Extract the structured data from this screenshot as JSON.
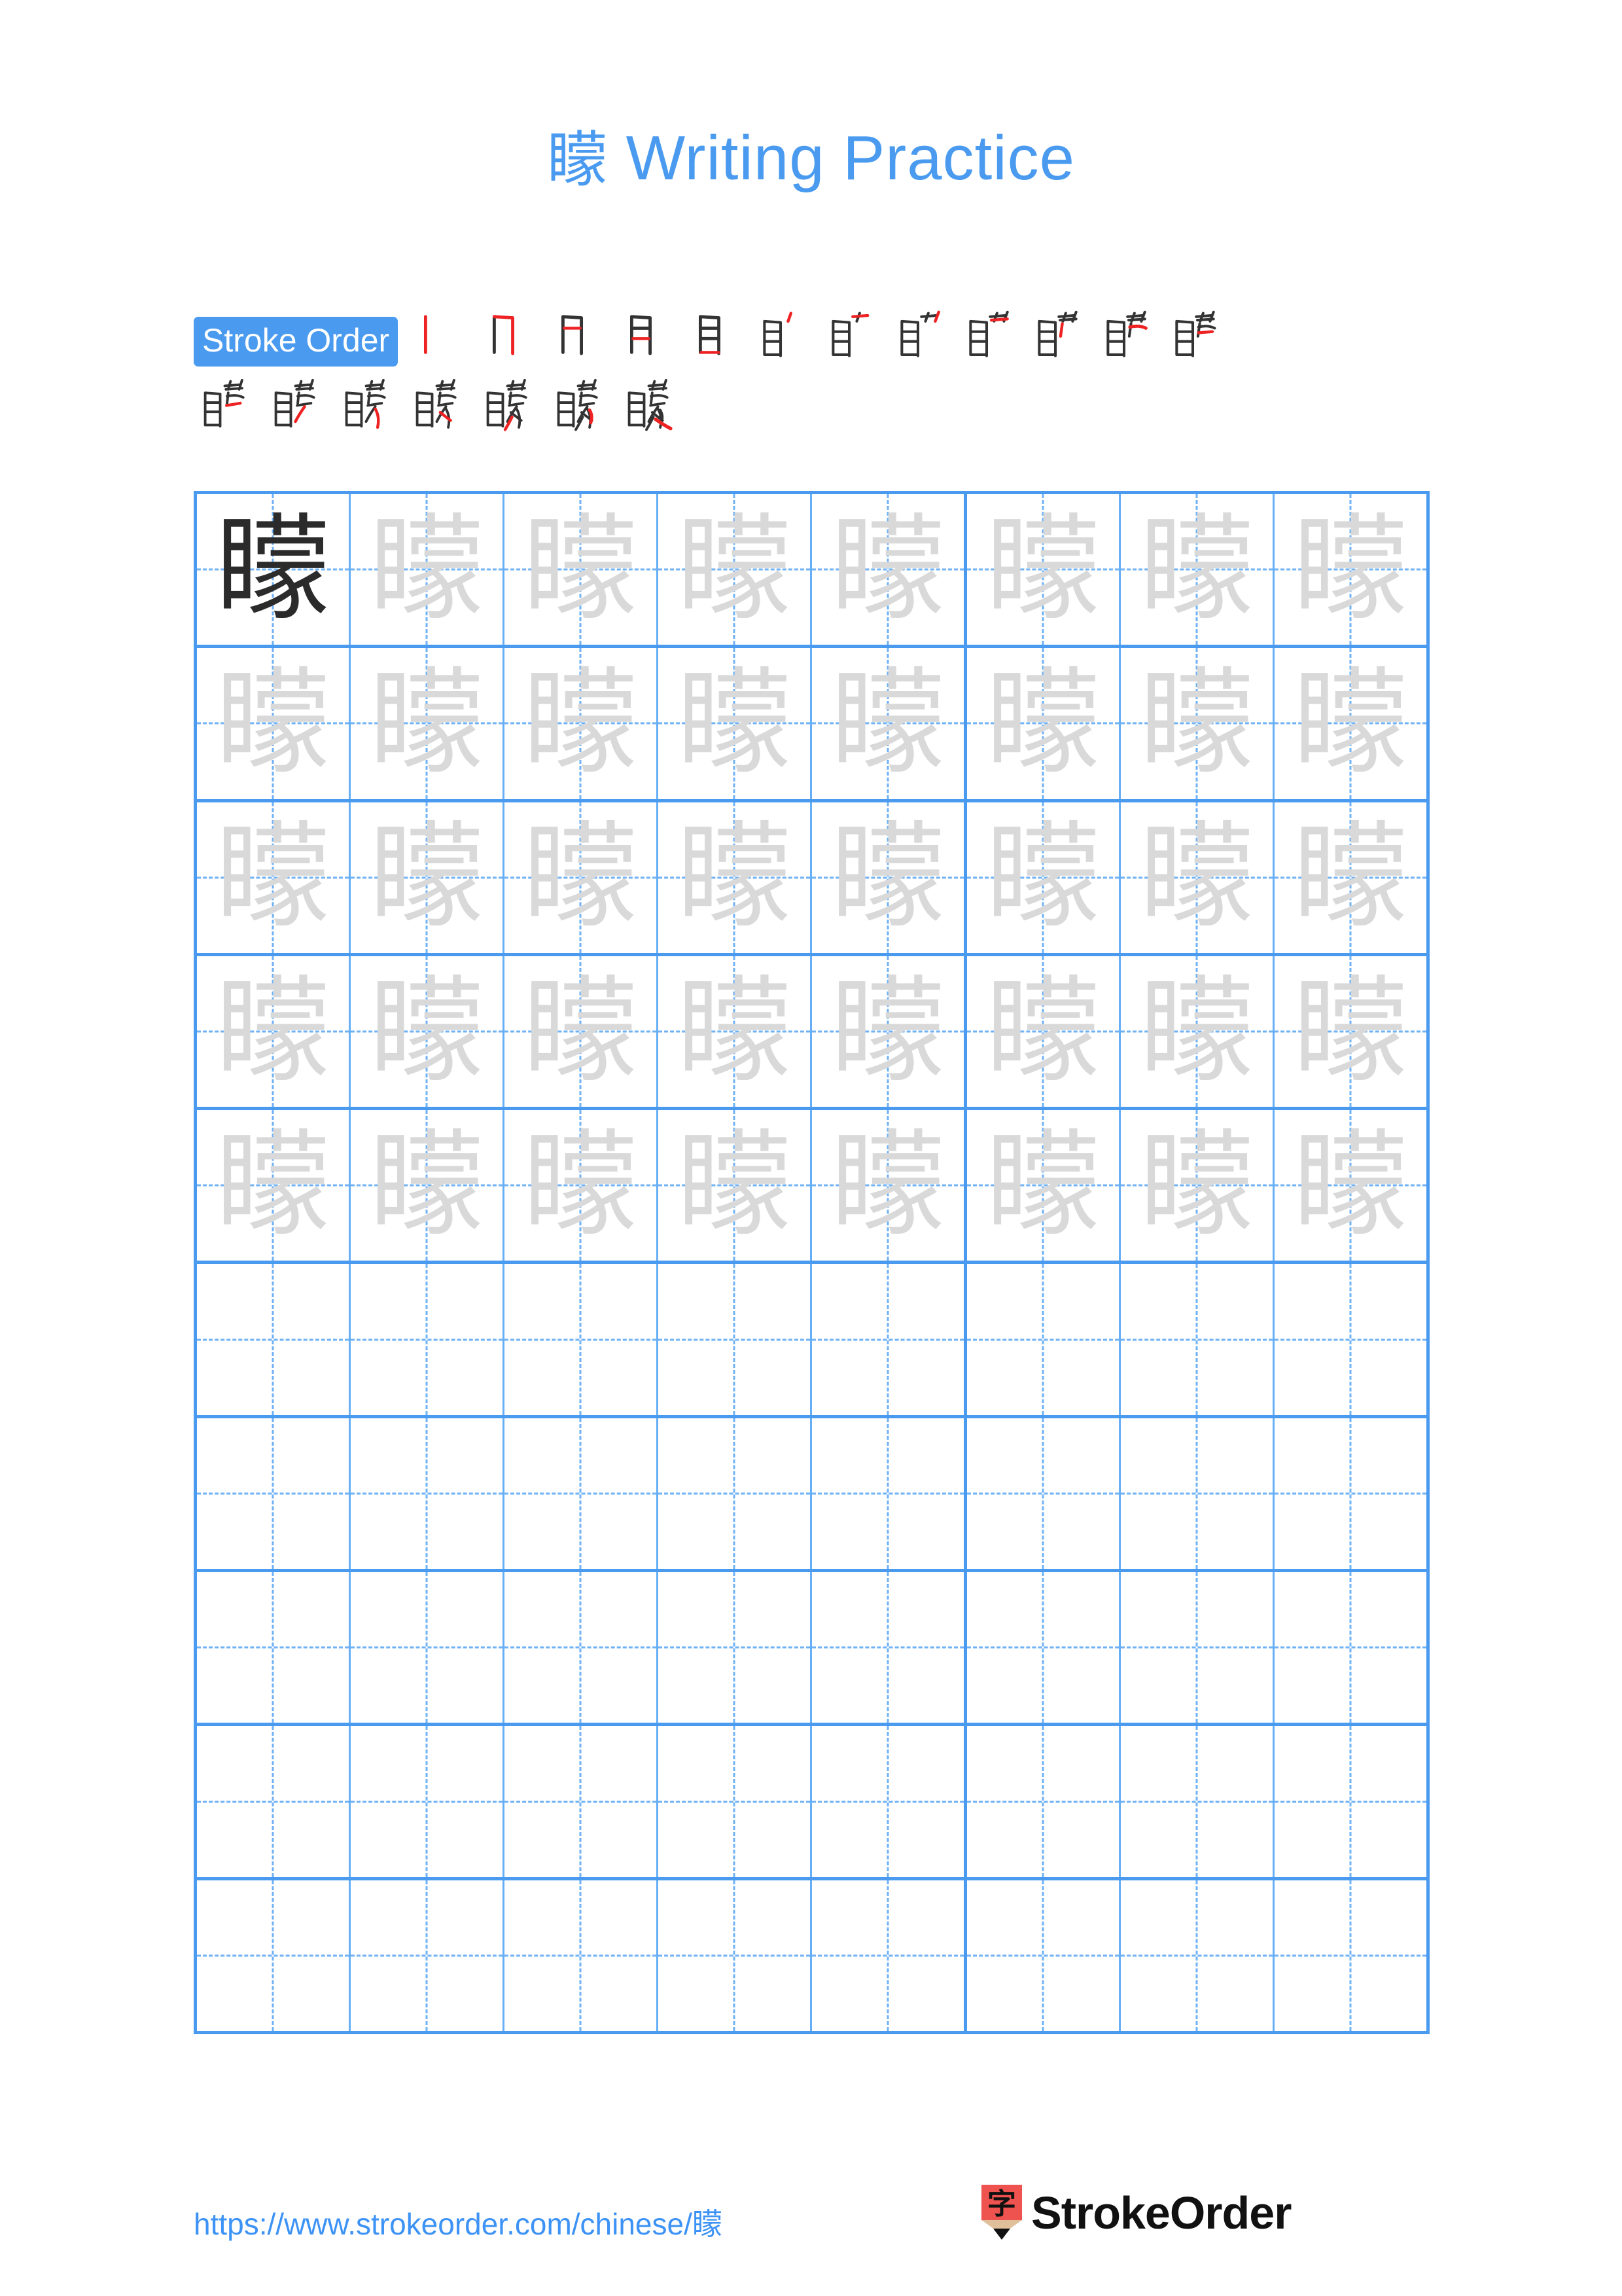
{
  "page": {
    "background": "#ffffff",
    "accent_color": "#4a9bf0",
    "stroke_highlight_color": "#ee2222",
    "stroke_done_color": "#333333",
    "trace_color": "#d9d9d9"
  },
  "header": {
    "character": "矇",
    "title_suffix": " Writing Practice",
    "title_full": "矇 Writing Practice"
  },
  "stroke_order": {
    "badge_label": "Stroke Order",
    "total_strokes": 19,
    "steps": [
      {
        "index": 1,
        "glyph": "丨"
      },
      {
        "index": 2,
        "glyph": "冂"
      },
      {
        "index": 3,
        "glyph": "月"
      },
      {
        "index": 4,
        "glyph": "月"
      },
      {
        "index": 5,
        "glyph": "目"
      },
      {
        "index": 6,
        "glyph": "目丶"
      },
      {
        "index": 7,
        "glyph": "目十"
      },
      {
        "index": 8,
        "glyph": "目艹"
      },
      {
        "index": 9,
        "glyph": "目艹"
      },
      {
        "index": 10,
        "glyph": "目艹"
      },
      {
        "index": 11,
        "glyph": "瞢"
      },
      {
        "index": 12,
        "glyph": "瞢"
      },
      {
        "index": 13,
        "glyph": "瞢"
      },
      {
        "index": 14,
        "glyph": "瞢"
      },
      {
        "index": 15,
        "glyph": "矇"
      },
      {
        "index": 16,
        "glyph": "矇"
      },
      {
        "index": 17,
        "glyph": "矇"
      },
      {
        "index": 18,
        "glyph": "矇"
      },
      {
        "index": 19,
        "glyph": "矇"
      }
    ]
  },
  "practice_grid": {
    "columns": 8,
    "rows": 10,
    "character": "矇",
    "filled_rows": 5,
    "solid_cells": 1,
    "grid_line_color": "#4a9bf0",
    "inner_line_color": "#66aef5",
    "dashed_line_color": "#6fb2f6"
  },
  "footer": {
    "url": "https://www.strokeorder.com/chinese/矇",
    "brand_name": "StrokeOrder",
    "brand_icon_char": "字",
    "brand_icon_color": "#ef5350"
  }
}
